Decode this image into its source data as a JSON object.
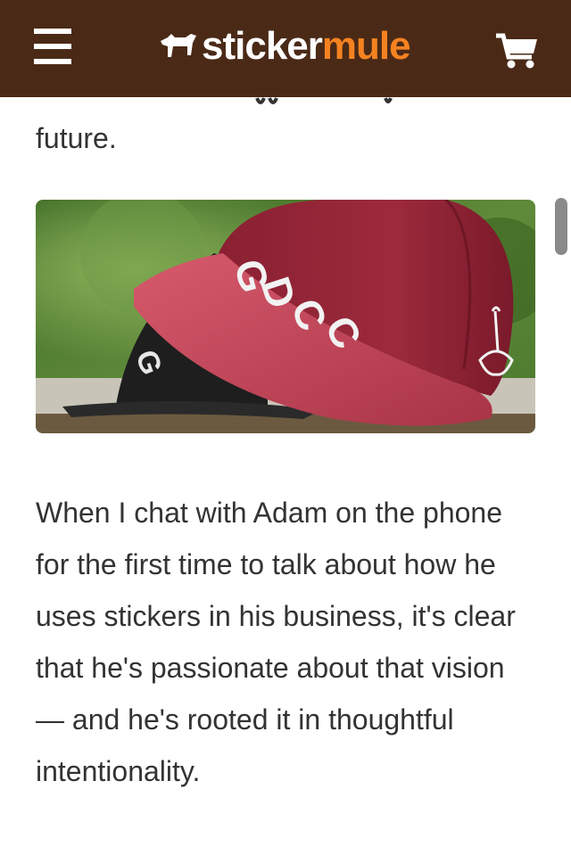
{
  "header": {
    "menu_icon": "hamburger-menu-icon",
    "logo_part1": "sticker",
    "logo_part2": "mule",
    "cart_icon": "shopping-cart-icon",
    "bg_color": "#4a2a17",
    "accent_color": "#f58220"
  },
  "article": {
    "previous_line_end": "future.",
    "image_caption_text": "GDCC",
    "paragraph": "When I chat with Adam on the phone for the first time to talk about how he uses stickers in his business, it's clear that he's passionate about that vision — and he's rooted it in thoughtful intentionality."
  }
}
